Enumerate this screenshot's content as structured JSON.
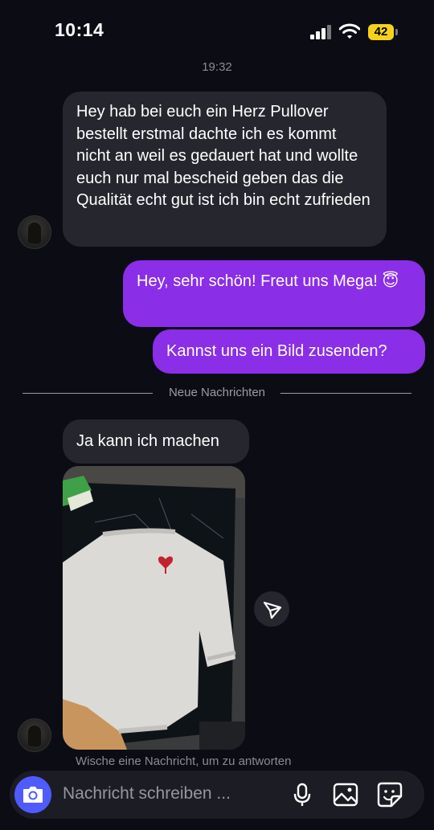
{
  "status_bar": {
    "time": "10:14",
    "battery": "42"
  },
  "chat": {
    "timestamp": "19:32",
    "messages": [
      {
        "from": "them",
        "text": "Hey hab bei euch ein Herz Pullover bestellt erstmal dachte ich es kommt nicht an weil es gedauert hat und wollte euch nur mal bescheid geben das die Qualität echt gut ist ich bin echt zufrieden"
      },
      {
        "from": "me",
        "text": "Hey, sehr schön! Freut uns Mega! 😇"
      },
      {
        "from": "me",
        "text": "Kannst uns ein Bild zusenden?"
      },
      {
        "from": "them",
        "text": "Ja kann ich machen"
      }
    ],
    "new_messages_divider": "Neue Nachrichten",
    "swipe_hint": "Wische eine Nachricht, um zu antworten"
  },
  "composer": {
    "placeholder": "Nachricht schreiben ..."
  },
  "colors": {
    "background": "#0c0d14",
    "sent_bubble": "#8a2ee8",
    "received_bubble": "#26272e",
    "camera_button": "#4f5bff",
    "battery": "#f5d31c"
  },
  "icons": [
    "camera-icon",
    "microphone-icon",
    "gallery-icon",
    "sticker-icon",
    "share-icon",
    "wifi-icon",
    "signal-icon"
  ]
}
